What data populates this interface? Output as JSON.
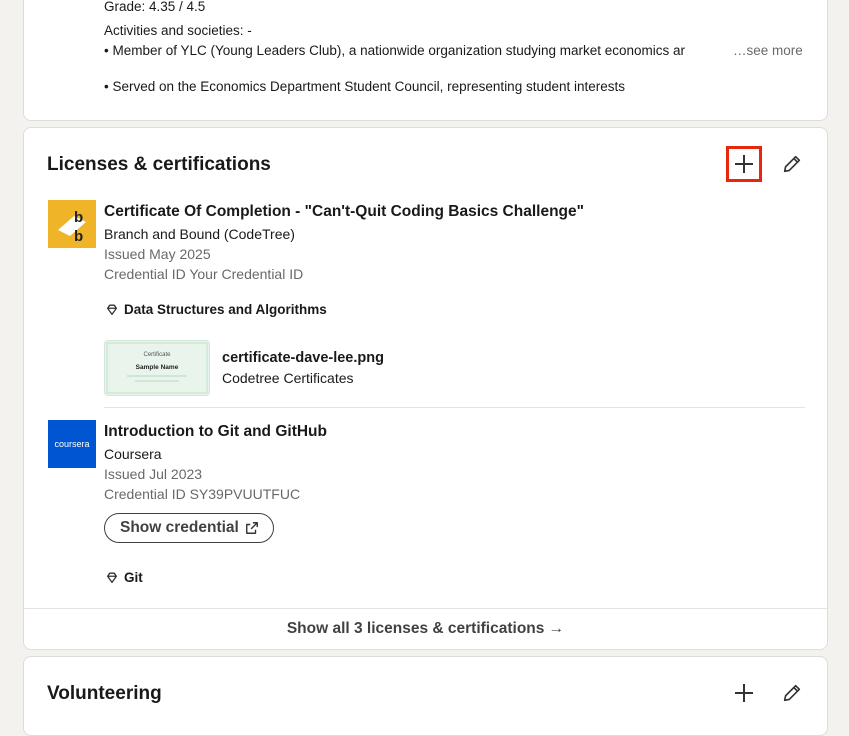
{
  "education": {
    "grade": "Grade: 4.35 / 4.5",
    "activities_label": "Activities and societies: -",
    "bullet_1": "• Member of YLC (Young Leaders Club), a nationwide organization studying market economics ar",
    "see_more": "…see more",
    "bullet_2": "• Served on the Economics Department Student Council, representing student interests"
  },
  "licenses": {
    "heading": "Licenses & certifications",
    "add_icon": "plus-icon",
    "edit_icon": "pencil-icon",
    "items": [
      {
        "logo_text": "bb",
        "logo_color": "#f0b429",
        "title": "Certificate Of Completion - \"Can't-Quit Coding Basics Challenge\"",
        "issuer": "Branch and Bound (CodeTree)",
        "issued": "Issued May 2025",
        "credential_id": "Credential ID Your Credential ID",
        "skill": "Data Structures and Algorithms",
        "media": {
          "filename": "certificate-dave-lee.png",
          "caption": "Codetree Certificates",
          "thumb_heading": "Certificate",
          "thumb_name": "Sample Name"
        }
      },
      {
        "logo_text": "coursera",
        "logo_color": "#0056d2",
        "title": "Introduction to Git and GitHub",
        "issuer": "Coursera",
        "issued": "Issued Jul 2023",
        "credential_id": "Credential ID SY39PVUUTFUC",
        "button_label": "Show credential",
        "skill": "Git"
      }
    ],
    "show_all": "Show all 3 licenses & certifications →"
  },
  "volunteering": {
    "heading": "Volunteering"
  },
  "colors": {
    "highlight": "#e8270f",
    "background": "#f4f2ee"
  }
}
